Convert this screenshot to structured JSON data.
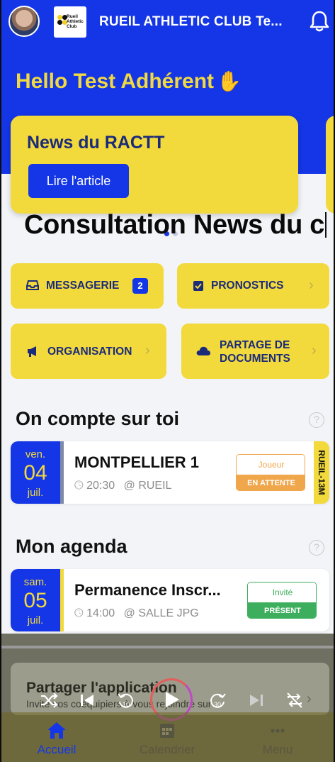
{
  "header": {
    "club_name": "RUEIL ATHLETIC CLUB Te...",
    "logo_text": "Rueil Athletic Club"
  },
  "greeting": "Hello Test Adhérent",
  "news": {
    "title": "News du RACTT",
    "button": "Lire l'article"
  },
  "caption": "Consultation News du c",
  "tiles": {
    "messagerie": {
      "label": "MESSAGERIE",
      "badge": "2"
    },
    "pronostics": {
      "label": "PRONOSTICS"
    },
    "organisation": {
      "label": "ORGANISATION"
    },
    "partage": {
      "label_line1": "PARTAGE DE",
      "label_line2": "DOCUMENTS"
    }
  },
  "on_compte": {
    "title": "On compte sur toi",
    "help": "?",
    "event": {
      "day_name": "ven.",
      "day": "04",
      "month": "juil.",
      "title": "MONTPELLIER 1",
      "time": "20:30",
      "location": "RUEIL",
      "role": "Joueur",
      "status": "EN ATTENTE",
      "team": "RUEIL-13M"
    }
  },
  "agenda": {
    "title": "Mon agenda",
    "help": "?",
    "event": {
      "day_name": "sam.",
      "day": "05",
      "month": "juil.",
      "title": "Permanence Inscr...",
      "time": "14:00",
      "location": "SALLE JPG",
      "role": "Invité",
      "status": "PRÉSENT"
    }
  },
  "share": {
    "title": "Partager l'application",
    "subtitle": "Invite vos coéquipiers à vous rejoindre sur"
  },
  "tabs": {
    "home": "Accueil",
    "calendar": "Calendrier",
    "menu": "Menu"
  },
  "colors": {
    "brand_blue": "#1436e6",
    "brand_yellow": "#f2d93c",
    "pending_orange": "#f0a64a",
    "present_green": "#3dae5d"
  }
}
